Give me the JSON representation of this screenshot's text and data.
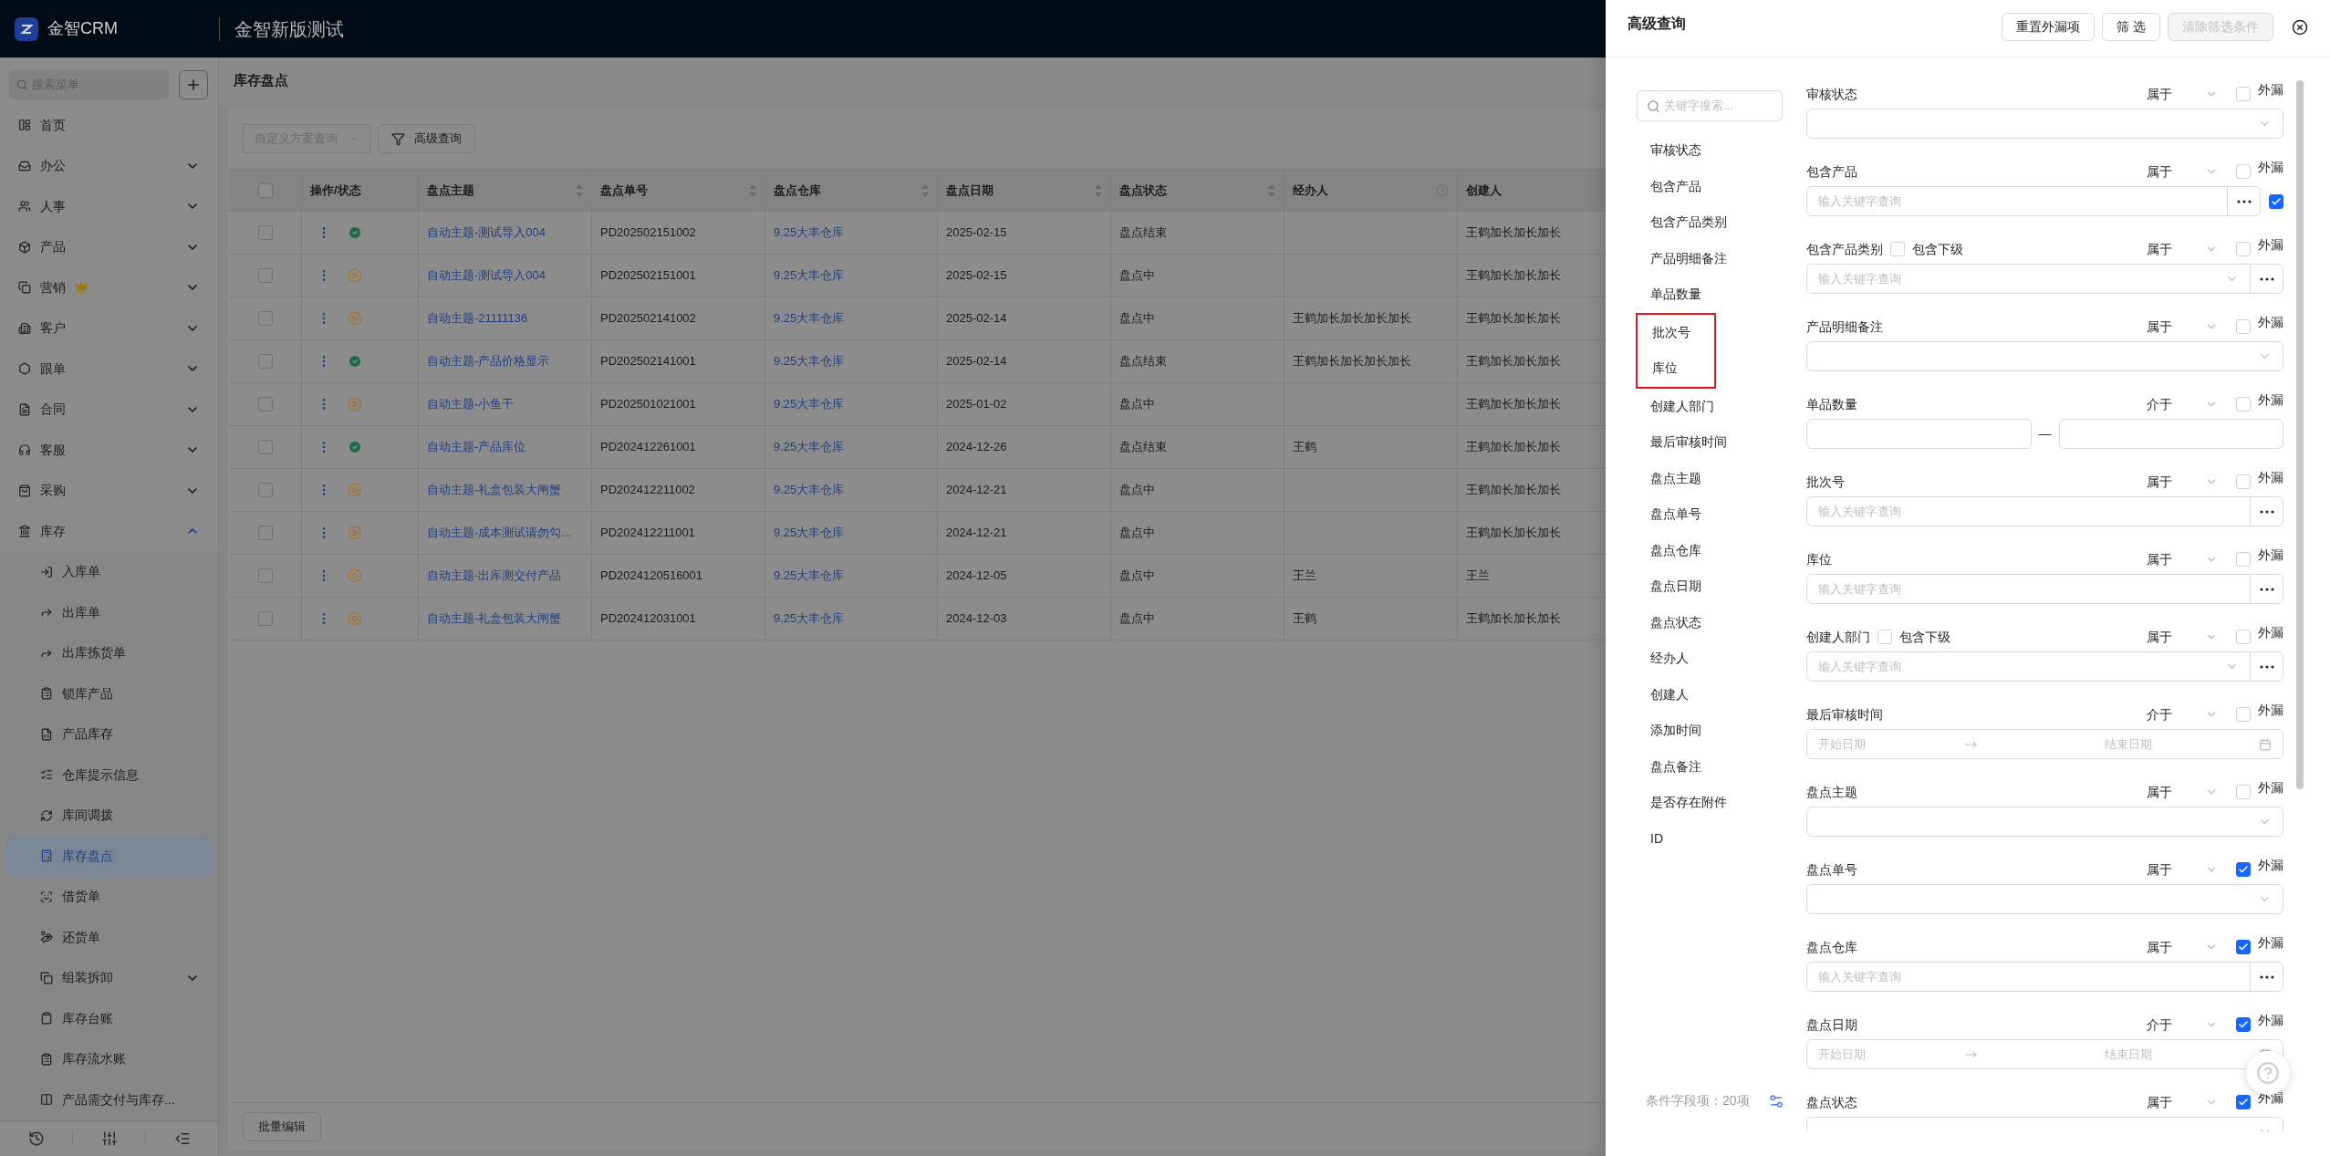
{
  "app": {
    "brand": "金智CRM",
    "title": "金智新版测试"
  },
  "sidebar": {
    "search": {
      "placeholder": "搜索菜单"
    },
    "items": [
      {
        "label": "首页",
        "selected": false
      },
      {
        "label": "办公",
        "selected": false,
        "expanded": false
      },
      {
        "label": "人事",
        "selected": false,
        "expanded": false
      },
      {
        "label": "产品",
        "selected": false,
        "expanded": false
      },
      {
        "label": "营销",
        "selected": false,
        "expanded": false,
        "premium": true
      },
      {
        "label": "客户",
        "selected": false,
        "expanded": false
      },
      {
        "label": "跟单",
        "selected": false,
        "expanded": false
      },
      {
        "label": "合同",
        "selected": false,
        "expanded": false
      },
      {
        "label": "客服",
        "selected": false,
        "expanded": false
      },
      {
        "label": "采购",
        "selected": false,
        "expanded": false
      },
      {
        "label": "库存",
        "selected": false,
        "expanded": true,
        "children": [
          {
            "label": "入库单",
            "selected": false
          },
          {
            "label": "出库单",
            "selected": false
          },
          {
            "label": "出库拣货单",
            "selected": false
          },
          {
            "label": "锁库产品",
            "selected": false
          },
          {
            "label": "产品库存",
            "selected": false
          },
          {
            "label": "仓库提示信息",
            "selected": false
          },
          {
            "label": "库间调拨",
            "selected": false
          },
          {
            "label": "库存盘点",
            "selected": true
          },
          {
            "label": "借货单",
            "selected": false
          },
          {
            "label": "还货单",
            "selected": false
          },
          {
            "label": "组装拆卸",
            "selected": false,
            "expanded": false
          },
          {
            "label": "库存台账",
            "selected": false
          },
          {
            "label": "库存流水账",
            "selected": false
          },
          {
            "label": "产品需交付与库存...",
            "selected": false
          }
        ]
      }
    ]
  },
  "page": {
    "title": "库存盘点",
    "toolbar": {
      "scheme": {
        "placeholder": "自定义方案查询"
      },
      "advanced_button": "高级查询"
    },
    "table": {
      "all_checked": false,
      "columns": [
        {
          "label": "操作/状态"
        },
        {
          "label": "盘点主题",
          "sortable": true
        },
        {
          "label": "盘点单号",
          "sortable": true
        },
        {
          "label": "盘点仓库",
          "sortable": true
        },
        {
          "label": "盘点日期",
          "sortable": true
        },
        {
          "label": "盘点状态",
          "sortable": true
        },
        {
          "label": "经办人",
          "help": true
        },
        {
          "label": "创建人"
        }
      ],
      "rows": [
        {
          "checked": false,
          "completed": true,
          "subject": "自动主题-测试导入004",
          "number": "PD202502151002",
          "warehouse": "9.25大丰仓库",
          "date": "2025-02-15",
          "state": "盘点结束",
          "creator": "王鹤加长加长加长"
        },
        {
          "checked": false,
          "completed": false,
          "subject": "自动主题-测试导入004",
          "number": "PD202502151001",
          "warehouse": "9.25大丰仓库",
          "date": "2025-02-15",
          "state": "盘点中",
          "creator": "王鹤加长加长加长"
        },
        {
          "checked": false,
          "completed": false,
          "subject": "自动主题-21111136",
          "number": "PD202502141002",
          "warehouse": "9.25大丰仓库",
          "date": "2025-02-14",
          "state": "盘点中",
          "handler": "王鹤加长加长加长加长",
          "creator": "王鹤加长加长加长"
        },
        {
          "checked": false,
          "completed": true,
          "subject": "自动主题-产品价格显示",
          "number": "PD202502141001",
          "warehouse": "9.25大丰仓库",
          "date": "2025-02-14",
          "state": "盘点结束",
          "handler": "王鹤加长加长加长加长",
          "creator": "王鹤加长加长加长"
        },
        {
          "checked": false,
          "completed": false,
          "subject": "自动主题-小鱼干",
          "number": "PD202501021001",
          "warehouse": "9.25大丰仓库",
          "date": "2025-01-02",
          "state": "盘点中",
          "creator": "王鹤加长加长加长"
        },
        {
          "checked": false,
          "completed": true,
          "subject": "自动主题-产品库位",
          "number": "PD202412261001",
          "warehouse": "9.25大丰仓库",
          "date": "2024-12-26",
          "state": "盘点结束",
          "handler": "王鹤",
          "creator": "王鹤加长加长加长"
        },
        {
          "checked": false,
          "completed": false,
          "subject": "自动主题-礼盒包装大闸蟹",
          "number": "PD202412211002",
          "warehouse": "9.25大丰仓库",
          "date": "2024-12-21",
          "state": "盘点中",
          "creator": "王鹤加长加长加长"
        },
        {
          "checked": false,
          "completed": false,
          "subject": "自动主题-成本测试请勿勾...",
          "number": "PD202412211001",
          "warehouse": "9.25大丰仓库",
          "date": "2024-12-21",
          "state": "盘点中",
          "creator": "王鹤加长加长加长"
        },
        {
          "checked": false,
          "completed": false,
          "subject": "自动主题-出库测交付产品",
          "number": "PD2024120516001",
          "warehouse": "9.25大丰仓库",
          "date": "2024-12-05",
          "state": "盘点中",
          "handler": "王兰",
          "creator": "王兰"
        },
        {
          "checked": false,
          "completed": false,
          "subject": "自动主题-礼盒包装大闸蟹",
          "number": "PD202412031001",
          "warehouse": "9.25大丰仓库",
          "date": "2024-12-03",
          "state": "盘点中",
          "handler": "王鹤",
          "creator": "王鹤加长加长加长"
        }
      ]
    },
    "footer_button": "批量编辑"
  },
  "panel": {
    "title": "高级查询",
    "buttons": [
      {
        "label": "重置外漏项",
        "disabled": false
      },
      {
        "label": "筛 选",
        "disabled": false
      },
      {
        "label": "清除筛选条件",
        "disabled": true
      }
    ],
    "field_search": {
      "placeholder": "关键字搜索..."
    },
    "field_list": [
      {
        "label": "审核状态",
        "highlighted": false
      },
      {
        "label": "包含产品",
        "highlighted": false
      },
      {
        "label": "包含产品类别",
        "highlighted": false
      },
      {
        "label": "产品明细备注",
        "highlighted": false
      },
      {
        "label": "单品数量",
        "highlighted": false
      },
      {
        "label": "批次号",
        "highlighted": true
      },
      {
        "label": "库位",
        "highlighted": true
      },
      {
        "label": "创建人部门",
        "highlighted": false
      },
      {
        "label": "最后审核时间",
        "highlighted": false
      },
      {
        "label": "盘点主题",
        "highlighted": false
      },
      {
        "label": "盘点单号",
        "highlighted": false
      },
      {
        "label": "盘点仓库",
        "highlighted": false
      },
      {
        "label": "盘点日期",
        "highlighted": false
      },
      {
        "label": "盘点状态",
        "highlighted": false
      },
      {
        "label": "经办人",
        "highlighted": false
      },
      {
        "label": "创建人",
        "highlighted": false
      },
      {
        "label": "添加时间",
        "highlighted": false
      },
      {
        "label": "盘点备注",
        "highlighted": false
      },
      {
        "label": "是否存在附件",
        "highlighted": false
      },
      {
        "label": "ID",
        "highlighted": false
      }
    ],
    "field_count": "条件字段项：20项",
    "fields": [
      {
        "kind": "select",
        "label": "审核状态",
        "operator": "属于",
        "omit_label": "外漏",
        "omit_checked": false
      },
      {
        "kind": "keyword",
        "label": "包含产品",
        "operator": "属于",
        "omit_label": "外漏",
        "omit_checked": false,
        "placeholder": "输入关键字查询",
        "extra_checked": true
      },
      {
        "kind": "keyword_select",
        "label": "包含产品类别",
        "include_sub": {
          "label": "包含下级",
          "checked": false
        },
        "operator": "属于",
        "omit_label": "外漏",
        "omit_checked": false,
        "placeholder": "输入关键字查询"
      },
      {
        "kind": "select",
        "label": "产品明细备注",
        "operator": "属于",
        "omit_label": "外漏",
        "omit_checked": false
      },
      {
        "kind": "range",
        "label": "单品数量",
        "operator": "介于",
        "omit_label": "外漏",
        "omit_checked": false,
        "separator": "—"
      },
      {
        "kind": "keyword",
        "label": "批次号",
        "operator": "属于",
        "omit_label": "外漏",
        "omit_checked": false,
        "placeholder": "输入关键字查询"
      },
      {
        "kind": "keyword",
        "label": "库位",
        "operator": "属于",
        "omit_label": "外漏",
        "omit_checked": false,
        "placeholder": "输入关键字查询"
      },
      {
        "kind": "keyword_select",
        "label": "创建人部门",
        "include_sub": {
          "label": "包含下级",
          "checked": false
        },
        "operator": "属于",
        "omit_label": "外漏",
        "omit_checked": false,
        "placeholder": "输入关键字查询"
      },
      {
        "kind": "date_range",
        "label": "最后审核时间",
        "operator": "介于",
        "omit_label": "外漏",
        "omit_checked": false,
        "start_placeholder": "开始日期",
        "end_placeholder": "结束日期"
      },
      {
        "kind": "select",
        "label": "盘点主题",
        "operator": "属于",
        "omit_label": "外漏",
        "omit_checked": false
      },
      {
        "kind": "select",
        "label": "盘点单号",
        "operator": "属于",
        "omit_label": "外漏",
        "omit_checked": true
      },
      {
        "kind": "keyword",
        "label": "盘点仓库",
        "operator": "属于",
        "omit_label": "外漏",
        "omit_checked": true,
        "placeholder": "输入关键字查询"
      },
      {
        "kind": "date_range",
        "label": "盘点日期",
        "operator": "介于",
        "omit_label": "外漏",
        "omit_checked": true,
        "start_placeholder": "开始日期",
        "end_placeholder": "结束日期"
      },
      {
        "kind": "select",
        "label": "盘点状态",
        "operator": "属于",
        "omit_label": "外漏",
        "omit_checked": true
      }
    ]
  }
}
